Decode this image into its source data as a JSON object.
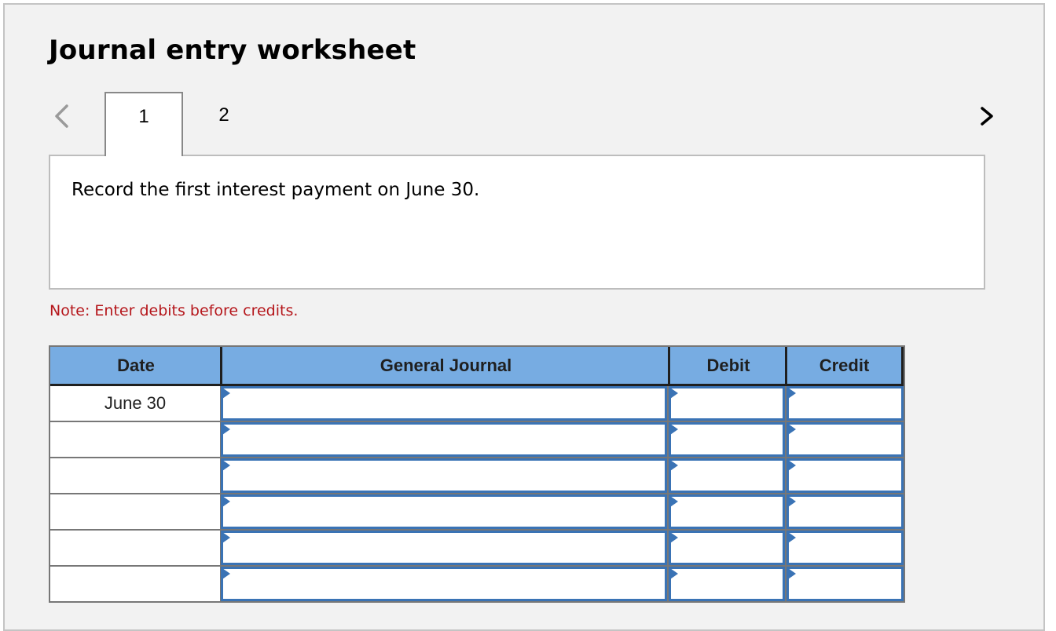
{
  "title": "Journal entry worksheet",
  "navigation": {
    "prev_icon": "chevron-left-icon",
    "next_icon": "chevron-right-icon",
    "tabs": [
      {
        "label": "1",
        "active": true
      },
      {
        "label": "2",
        "active": false
      }
    ]
  },
  "instruction": "Record the first interest payment on June 30.",
  "note": "Note: Enter debits before credits.",
  "table": {
    "columns": [
      "Date",
      "General Journal",
      "Debit",
      "Credit"
    ],
    "rows": [
      {
        "date": "June 30",
        "account": "",
        "debit": "",
        "credit": ""
      },
      {
        "date": "",
        "account": "",
        "debit": "",
        "credit": ""
      },
      {
        "date": "",
        "account": "",
        "debit": "",
        "credit": ""
      },
      {
        "date": "",
        "account": "",
        "debit": "",
        "credit": ""
      },
      {
        "date": "",
        "account": "",
        "debit": "",
        "credit": ""
      },
      {
        "date": "",
        "account": "",
        "debit": "",
        "credit": ""
      }
    ]
  },
  "colors": {
    "header_bg": "#77ace2",
    "input_border": "#3a73b5",
    "note_text": "#b5161b"
  }
}
